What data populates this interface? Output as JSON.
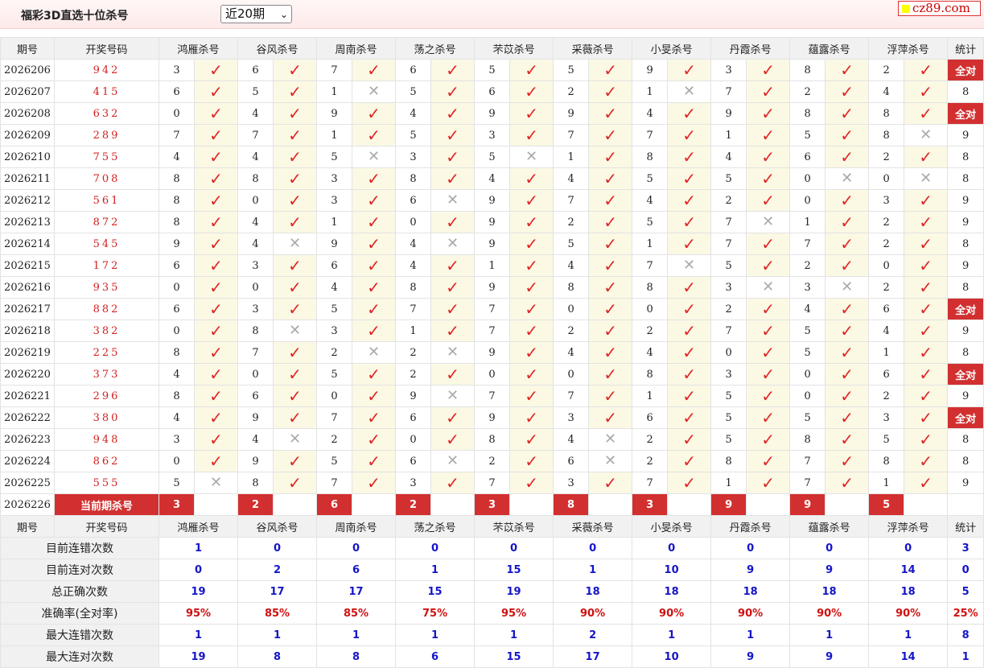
{
  "header": {
    "title": "福彩3D直选十位杀号",
    "select_value": "近20期",
    "logo_text": "cz89.com"
  },
  "columns": {
    "period": "期号",
    "draw": "开奖号码",
    "stats": "统计",
    "experts": [
      "鸿雁杀号",
      "谷风杀号",
      "周南杀号",
      "荡之杀号",
      "芣苡杀号",
      "采薇杀号",
      "小旻杀号",
      "丹霞杀号",
      "蕴露杀号",
      "浮萍杀号"
    ]
  },
  "check_glyph": "✓",
  "cross_glyph": "✕",
  "rows": [
    {
      "period": "2026206",
      "draw": "942",
      "kills": [
        3,
        6,
        7,
        6,
        5,
        5,
        9,
        3,
        8,
        2
      ],
      "ok": [
        1,
        1,
        1,
        1,
        1,
        1,
        1,
        1,
        1,
        1
      ],
      "stat": "全对"
    },
    {
      "period": "2026207",
      "draw": "415",
      "kills": [
        6,
        5,
        1,
        5,
        6,
        2,
        1,
        7,
        2,
        4
      ],
      "ok": [
        1,
        1,
        0,
        1,
        1,
        1,
        0,
        1,
        1,
        1
      ],
      "stat": "8"
    },
    {
      "period": "2026208",
      "draw": "632",
      "kills": [
        0,
        4,
        9,
        4,
        9,
        9,
        4,
        9,
        8,
        8
      ],
      "ok": [
        1,
        1,
        1,
        1,
        1,
        1,
        1,
        1,
        1,
        1
      ],
      "stat": "全对"
    },
    {
      "period": "2026209",
      "draw": "289",
      "kills": [
        7,
        7,
        1,
        5,
        3,
        7,
        7,
        1,
        5,
        8
      ],
      "ok": [
        1,
        1,
        1,
        1,
        1,
        1,
        1,
        1,
        1,
        0
      ],
      "stat": "9"
    },
    {
      "period": "2026210",
      "draw": "755",
      "kills": [
        4,
        4,
        5,
        3,
        5,
        1,
        8,
        4,
        6,
        2
      ],
      "ok": [
        1,
        1,
        0,
        1,
        0,
        1,
        1,
        1,
        1,
        1
      ],
      "stat": "8"
    },
    {
      "period": "2026211",
      "draw": "708",
      "kills": [
        8,
        8,
        3,
        8,
        4,
        4,
        5,
        5,
        0,
        0
      ],
      "ok": [
        1,
        1,
        1,
        1,
        1,
        1,
        1,
        1,
        0,
        0
      ],
      "stat": "8"
    },
    {
      "period": "2026212",
      "draw": "561",
      "kills": [
        8,
        0,
        3,
        6,
        9,
        7,
        4,
        2,
        0,
        3
      ],
      "ok": [
        1,
        1,
        1,
        0,
        1,
        1,
        1,
        1,
        1,
        1
      ],
      "stat": "9"
    },
    {
      "period": "2026213",
      "draw": "872",
      "kills": [
        8,
        4,
        1,
        0,
        9,
        2,
        5,
        7,
        1,
        2
      ],
      "ok": [
        1,
        1,
        1,
        1,
        1,
        1,
        1,
        0,
        1,
        1
      ],
      "stat": "9"
    },
    {
      "period": "2026214",
      "draw": "545",
      "kills": [
        9,
        4,
        9,
        4,
        9,
        5,
        1,
        7,
        7,
        2
      ],
      "ok": [
        1,
        0,
        1,
        0,
        1,
        1,
        1,
        1,
        1,
        1
      ],
      "stat": "8"
    },
    {
      "period": "2026215",
      "draw": "172",
      "kills": [
        6,
        3,
        6,
        4,
        1,
        4,
        7,
        5,
        2,
        0
      ],
      "ok": [
        1,
        1,
        1,
        1,
        1,
        1,
        0,
        1,
        1,
        1
      ],
      "stat": "9"
    },
    {
      "period": "2026216",
      "draw": "935",
      "kills": [
        0,
        0,
        4,
        8,
        9,
        8,
        8,
        3,
        3,
        2
      ],
      "ok": [
        1,
        1,
        1,
        1,
        1,
        1,
        1,
        0,
        0,
        1
      ],
      "stat": "8"
    },
    {
      "period": "2026217",
      "draw": "882",
      "kills": [
        6,
        3,
        5,
        7,
        7,
        0,
        0,
        2,
        4,
        6
      ],
      "ok": [
        1,
        1,
        1,
        1,
        1,
        1,
        1,
        1,
        1,
        1
      ],
      "stat": "全对"
    },
    {
      "period": "2026218",
      "draw": "382",
      "kills": [
        0,
        8,
        3,
        1,
        7,
        2,
        2,
        7,
        5,
        4
      ],
      "ok": [
        1,
        0,
        1,
        1,
        1,
        1,
        1,
        1,
        1,
        1
      ],
      "stat": "9"
    },
    {
      "period": "2026219",
      "draw": "225",
      "kills": [
        8,
        7,
        2,
        2,
        9,
        4,
        4,
        0,
        5,
        1
      ],
      "ok": [
        1,
        1,
        0,
        0,
        1,
        1,
        1,
        1,
        1,
        1
      ],
      "stat": "8"
    },
    {
      "period": "2026220",
      "draw": "373",
      "kills": [
        4,
        0,
        5,
        2,
        0,
        0,
        8,
        3,
        0,
        6
      ],
      "ok": [
        1,
        1,
        1,
        1,
        1,
        1,
        1,
        1,
        1,
        1
      ],
      "stat": "全对"
    },
    {
      "period": "2026221",
      "draw": "296",
      "kills": [
        8,
        6,
        0,
        9,
        7,
        7,
        1,
        5,
        0,
        2
      ],
      "ok": [
        1,
        1,
        1,
        0,
        1,
        1,
        1,
        1,
        1,
        1
      ],
      "stat": "9"
    },
    {
      "period": "2026222",
      "draw": "380",
      "kills": [
        4,
        9,
        7,
        6,
        9,
        3,
        6,
        5,
        5,
        3
      ],
      "ok": [
        1,
        1,
        1,
        1,
        1,
        1,
        1,
        1,
        1,
        1
      ],
      "stat": "全对"
    },
    {
      "period": "2026223",
      "draw": "948",
      "kills": [
        3,
        4,
        2,
        0,
        8,
        4,
        2,
        5,
        8,
        5
      ],
      "ok": [
        1,
        0,
        1,
        1,
        1,
        0,
        1,
        1,
        1,
        1
      ],
      "stat": "8"
    },
    {
      "period": "2026224",
      "draw": "862",
      "kills": [
        0,
        9,
        5,
        6,
        2,
        6,
        2,
        8,
        7,
        8
      ],
      "ok": [
        1,
        1,
        1,
        0,
        1,
        0,
        1,
        1,
        1,
        1
      ],
      "stat": "8"
    },
    {
      "period": "2026225",
      "draw": "555",
      "kills": [
        5,
        8,
        7,
        3,
        7,
        3,
        7,
        1,
        7,
        1
      ],
      "ok": [
        0,
        1,
        1,
        1,
        1,
        1,
        1,
        1,
        1,
        1
      ],
      "stat": "9"
    }
  ],
  "current": {
    "period": "2026226",
    "label": "当前期杀号",
    "kills": [
      3,
      2,
      6,
      2,
      3,
      8,
      3,
      9,
      9,
      5
    ]
  },
  "summary": [
    {
      "label": "目前连错次数",
      "values": [
        "1",
        "0",
        "0",
        "0",
        "0",
        "0",
        "0",
        "0",
        "0",
        "0"
      ],
      "total": "3",
      "color": "blue"
    },
    {
      "label": "目前连对次数",
      "values": [
        "0",
        "2",
        "6",
        "1",
        "15",
        "1",
        "10",
        "9",
        "9",
        "14"
      ],
      "total": "0",
      "color": "blue"
    },
    {
      "label": "总正确次数",
      "values": [
        "19",
        "17",
        "17",
        "15",
        "19",
        "18",
        "18",
        "18",
        "18",
        "18"
      ],
      "total": "5",
      "color": "blue"
    },
    {
      "label": "准确率(全对率)",
      "values": [
        "95%",
        "85%",
        "85%",
        "75%",
        "95%",
        "90%",
        "90%",
        "90%",
        "90%",
        "90%"
      ],
      "total": "25%",
      "color": "red"
    },
    {
      "label": "最大连错次数",
      "values": [
        "1",
        "1",
        "1",
        "1",
        "1",
        "2",
        "1",
        "1",
        "1",
        "1"
      ],
      "total": "8",
      "color": "blue"
    },
    {
      "label": "最大连对次数",
      "values": [
        "19",
        "8",
        "8",
        "6",
        "15",
        "17",
        "10",
        "9",
        "9",
        "14"
      ],
      "total": "1",
      "color": "blue"
    }
  ],
  "colors": {
    "accent_red": "#d23030",
    "check": "#e02525",
    "blue": "#1515c8"
  }
}
